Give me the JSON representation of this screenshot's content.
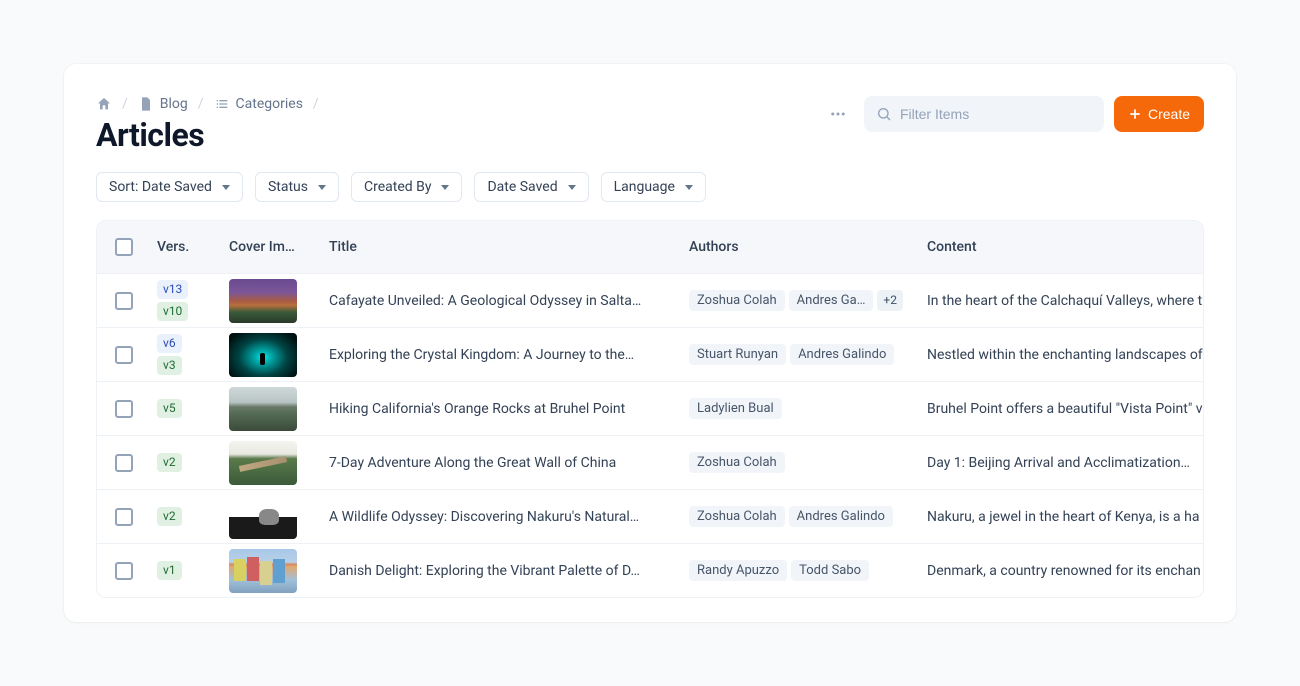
{
  "breadcrumbs": {
    "items": [
      "Blog",
      "Categories"
    ]
  },
  "page_title": "Articles",
  "actions": {
    "search_placeholder": "Filter Items",
    "create_label": "Create"
  },
  "filters": [
    {
      "label": "Sort: Date Saved"
    },
    {
      "label": "Status"
    },
    {
      "label": "Created By"
    },
    {
      "label": "Date Saved"
    },
    {
      "label": "Language"
    }
  ],
  "columns": {
    "vers": "Vers.",
    "cover": "Cover Im…",
    "title": "Title",
    "authors": "Authors",
    "content": "Content"
  },
  "rows": [
    {
      "versions": [
        {
          "label": "v13",
          "variant": "blue"
        },
        {
          "label": "v10",
          "variant": "green"
        }
      ],
      "title": "Cafayate Unveiled: A Geological Odyssey in Salta…",
      "authors": [
        "Zoshua Colah",
        "Andres Ga…"
      ],
      "authors_overflow": "+2",
      "content": "In the heart of the Calchaquí Valleys, where t"
    },
    {
      "versions": [
        {
          "label": "v6",
          "variant": "blue"
        },
        {
          "label": "v3",
          "variant": "green"
        }
      ],
      "title": "Exploring the Crystal Kingdom: A Journey to the…",
      "authors": [
        "Stuart Runyan",
        "Andres Galindo"
      ],
      "authors_overflow": "",
      "content": "Nestled within the enchanting landscapes of"
    },
    {
      "versions": [
        {
          "label": "v5",
          "variant": "green"
        }
      ],
      "title": "Hiking California's Orange Rocks at Bruhel Point",
      "authors": [
        "Ladylien Bual"
      ],
      "authors_overflow": "",
      "content": "Bruhel Point offers a beautiful \"Vista Point\" v"
    },
    {
      "versions": [
        {
          "label": "v2",
          "variant": "green"
        }
      ],
      "title": "7-Day Adventure Along the Great Wall of China",
      "authors": [
        "Zoshua Colah"
      ],
      "authors_overflow": "",
      "content": "Day 1: Beijing Arrival and Acclimatization…"
    },
    {
      "versions": [
        {
          "label": "v2",
          "variant": "green"
        }
      ],
      "title": "A Wildlife Odyssey: Discovering Nakuru's Natural…",
      "authors": [
        "Zoshua Colah",
        "Andres Galindo"
      ],
      "authors_overflow": "",
      "content": "Nakuru, a jewel in the heart of Kenya, is a ha"
    },
    {
      "versions": [
        {
          "label": "v1",
          "variant": "green"
        }
      ],
      "title": "Danish Delight: Exploring the Vibrant Palette of D…",
      "authors": [
        "Randy Apuzzo",
        "Todd Sabo"
      ],
      "authors_overflow": "",
      "content": "Denmark, a country renowned for its enchan"
    }
  ]
}
